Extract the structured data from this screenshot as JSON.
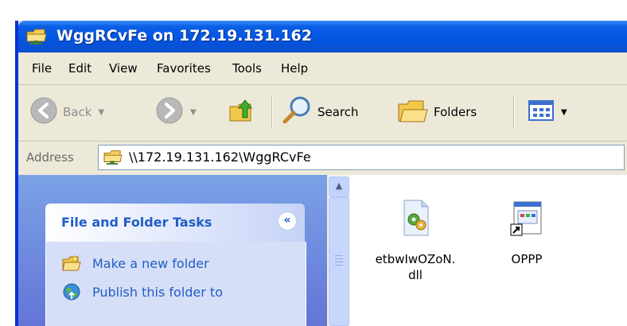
{
  "window": {
    "title": "WggRCvFe on 172.19.131.162",
    "title_icon": "network-folder-icon"
  },
  "menu": [
    "File",
    "Edit",
    "View",
    "Favorites",
    "Tools",
    "Help"
  ],
  "toolbar": {
    "back_label": "Back",
    "search_label": "Search",
    "folders_label": "Folders"
  },
  "address": {
    "label": "Address",
    "value": "\\\\172.19.131.162\\WggRCvFe"
  },
  "tasks": {
    "title": "File and Folder Tasks",
    "items": [
      {
        "label": "Make a new folder",
        "icon": "new-folder-icon"
      },
      {
        "label": "Publish this folder to",
        "icon": "globe-publish-icon"
      }
    ]
  },
  "files": [
    {
      "name": "etbwIwOZoN.\ndll",
      "icon": "dll-file-icon"
    },
    {
      "name": "OPPP",
      "icon": "shortcut-icon"
    }
  ],
  "colors": {
    "titlebar": "#0a5fe5",
    "taskpane": "#7ba2e7",
    "link": "#215dc6",
    "chrome": "#ece9d8"
  }
}
